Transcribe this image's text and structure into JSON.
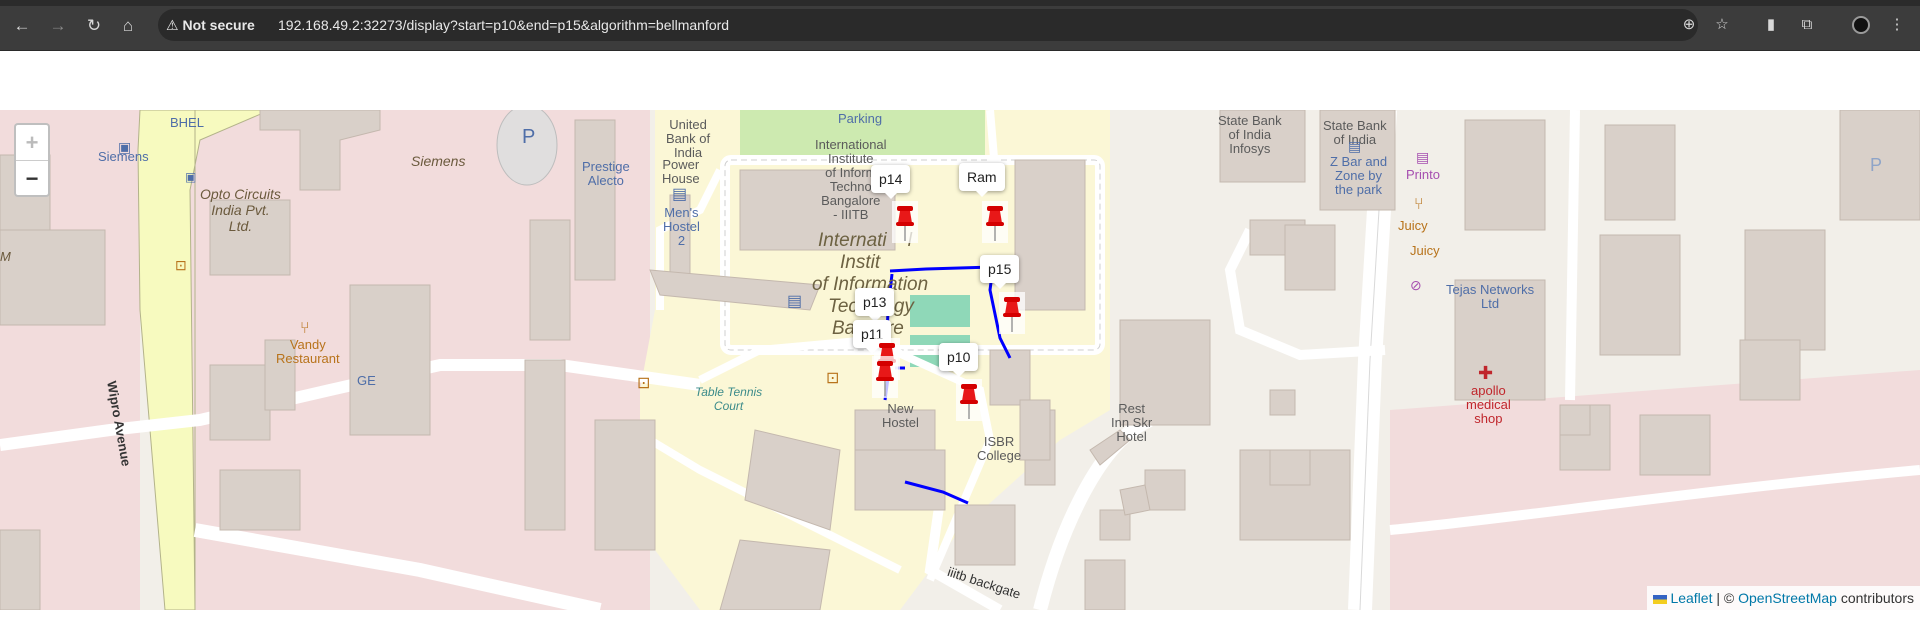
{
  "browser": {
    "security_label": "Not secure",
    "url": "192.168.49.2:32273/display?start=p10&end=p15&algorithm=bellmanford"
  },
  "map": {
    "zoom_in": "+",
    "zoom_out": "−",
    "markers": [
      "p14",
      "Ram",
      "p15",
      "p13",
      "p11",
      "p10"
    ],
    "route_color": "#0000ff",
    "places": {
      "bhel": "BHEL",
      "siemens_bus": "Siemens",
      "siemens": "Siemens",
      "opto1": "Opto Circuits",
      "opto2": "India Pvt.",
      "opto3": "Ltd.",
      "prestige1": "Prestige",
      "prestige2": "Alecto",
      "ubi1": "United",
      "ubi2": "Bank of",
      "ubi3": "India",
      "power1": "Power",
      "power2": "House",
      "parking": "Parking",
      "iiit1": "International",
      "iiit2": "Institute",
      "iiit3": "of Inform",
      "iiit4": "Techno",
      "iiit5": "Bangalore",
      "iiit6": "- IIITB",
      "mens1": "Men's",
      "mens2": "Hostel",
      "mens3": "2",
      "big1": "Internati",
      "big1b": "l",
      "big2": "Instit",
      "big3": "of Information",
      "big4": "Tech",
      "big4b": "logy",
      "big5": "Ba",
      "big5b": "ore",
      "sbi_infosys1": "State Bank",
      "sbi_infosys2": "of India",
      "sbi_infosys3": "Infosys",
      "sbi1": "State Bank",
      "sbi2": "of India",
      "zbar1": "Z Bar and",
      "zbar2": "Zone by",
      "zbar3": "the park",
      "printo": "Printo",
      "juicy1": "Juicy",
      "juicy2": "Juicy",
      "tejas1": "Tejas Networks",
      "tejas2": "Ltd",
      "vandy1": "Vandy",
      "vandy2": "Restaurant",
      "ge": "GE",
      "wipro": "Wipro Avenue",
      "tt1": "Table Tennis",
      "tt2": "Court",
      "newhostel1": "New",
      "newhostel2": "Hostel",
      "isbr1": "ISBR",
      "isbr2": "College",
      "rest1": "Rest",
      "rest2": "Inn Skr",
      "rest3": "Hotel",
      "apollo1": "apollo",
      "apollo2": "medical",
      "apollo3": "shop",
      "backgate": "iiitb backgate",
      "m": "M",
      "p1": "P",
      "p2": "P"
    },
    "attribution": {
      "leaflet": "Leaflet",
      "sep": " | © ",
      "osm": "OpenStreetMap",
      "contrib": " contributors"
    }
  }
}
